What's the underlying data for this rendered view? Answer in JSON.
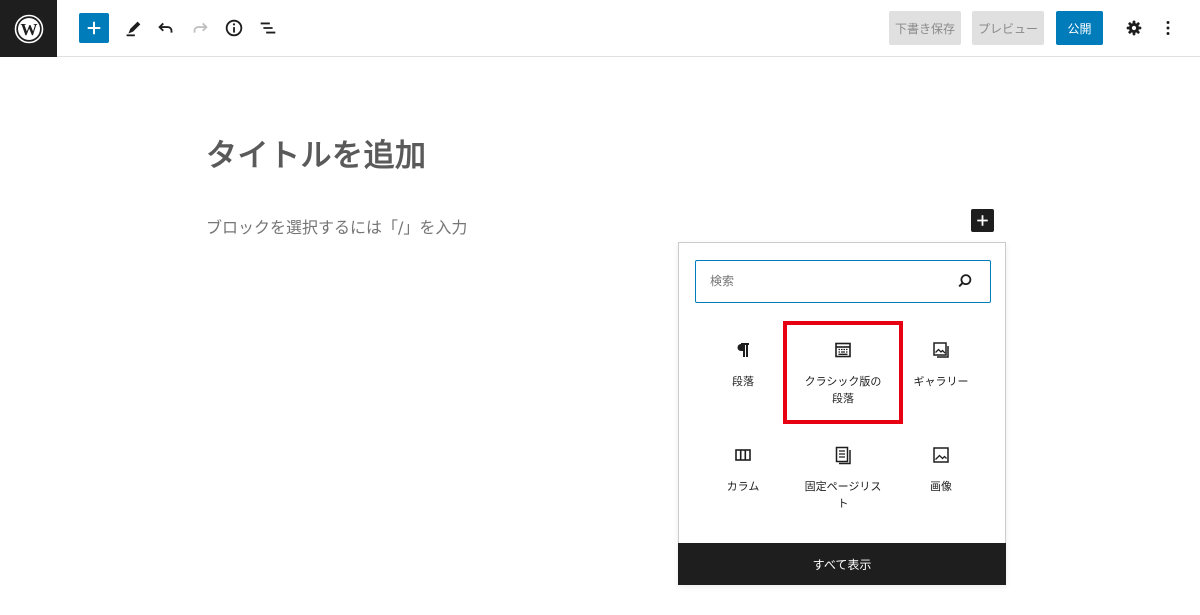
{
  "toolbar": {
    "logo_icon": "wordpress-icon",
    "add_icon": "plus-icon",
    "edit_icon": "pencil-icon",
    "undo_icon": "undo-icon",
    "redo_icon": "redo-icon",
    "info_icon": "info-icon",
    "outline_icon": "list-view-icon",
    "save_draft_label": "下書き保存",
    "preview_label": "プレビュー",
    "publish_label": "公開",
    "settings_icon": "gear-icon",
    "more_icon": "more-vertical-icon",
    "accent_color": "#007cba"
  },
  "editor": {
    "title_placeholder": "タイトルを追加",
    "block_placeholder": "ブロックを選択するには「/」を入力"
  },
  "inserter": {
    "search_placeholder": "検索",
    "blocks": [
      {
        "label": "段落",
        "icon": "paragraph-icon"
      },
      {
        "label": "クラシック版の段落",
        "icon": "classic-icon"
      },
      {
        "label": "ギャラリー",
        "icon": "gallery-icon"
      },
      {
        "label": "カラム",
        "icon": "columns-icon"
      },
      {
        "label": "固定ページリスト",
        "icon": "page-list-icon"
      },
      {
        "label": "画像",
        "icon": "image-icon"
      }
    ],
    "show_all_label": "すべて表示",
    "highlight_color": "#e60012"
  }
}
